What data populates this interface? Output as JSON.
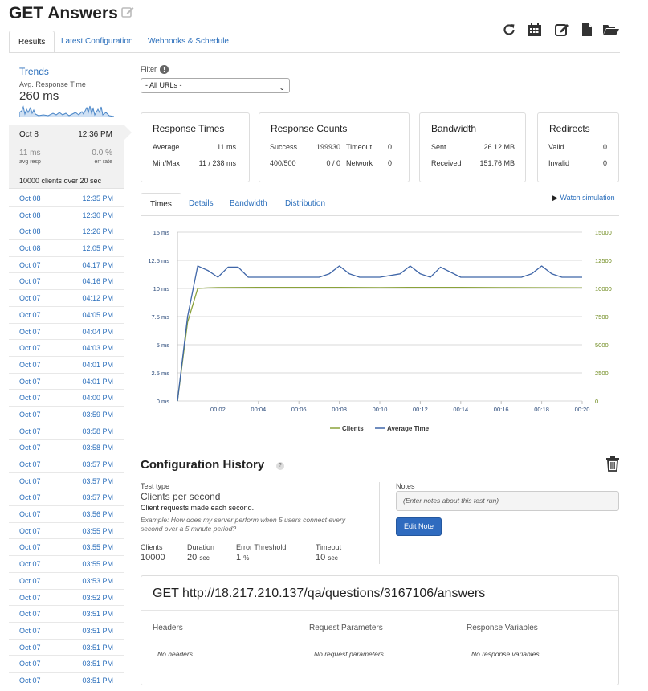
{
  "header": {
    "title": "GET Answers",
    "tabs": [
      {
        "label": "Results",
        "active": true
      },
      {
        "label": "Latest Configuration",
        "active": false
      },
      {
        "label": "Webhooks & Schedule",
        "active": false
      }
    ],
    "toolbar_icons": [
      "refresh-icon",
      "calendar-icon",
      "edit-icon",
      "file-icon",
      "folder-open-icon"
    ]
  },
  "sidebar": {
    "trends_label": "Trends",
    "avg_label": "Avg. Response Time",
    "avg_value": "260 ms",
    "selected": {
      "date": "Oct 8",
      "time": "12:36 PM",
      "resp_value": "11 ms",
      "resp_label": "avg resp",
      "err_value": "0.0 %",
      "err_label": "err rate",
      "summary": "10000 clients over 20 sec"
    },
    "runs": [
      {
        "date": "Oct 08",
        "time": "12:35 PM"
      },
      {
        "date": "Oct 08",
        "time": "12:30 PM"
      },
      {
        "date": "Oct 08",
        "time": "12:26 PM"
      },
      {
        "date": "Oct 08",
        "time": "12:05 PM"
      },
      {
        "date": "Oct 07",
        "time": "04:17 PM"
      },
      {
        "date": "Oct 07",
        "time": "04:16 PM"
      },
      {
        "date": "Oct 07",
        "time": "04:12 PM"
      },
      {
        "date": "Oct 07",
        "time": "04:05 PM"
      },
      {
        "date": "Oct 07",
        "time": "04:04 PM"
      },
      {
        "date": "Oct 07",
        "time": "04:03 PM"
      },
      {
        "date": "Oct 07",
        "time": "04:01 PM"
      },
      {
        "date": "Oct 07",
        "time": "04:01 PM"
      },
      {
        "date": "Oct 07",
        "time": "04:00 PM"
      },
      {
        "date": "Oct 07",
        "time": "03:59 PM"
      },
      {
        "date": "Oct 07",
        "time": "03:58 PM"
      },
      {
        "date": "Oct 07",
        "time": "03:58 PM"
      },
      {
        "date": "Oct 07",
        "time": "03:57 PM"
      },
      {
        "date": "Oct 07",
        "time": "03:57 PM"
      },
      {
        "date": "Oct 07",
        "time": "03:57 PM"
      },
      {
        "date": "Oct 07",
        "time": "03:56 PM"
      },
      {
        "date": "Oct 07",
        "time": "03:55 PM"
      },
      {
        "date": "Oct 07",
        "time": "03:55 PM"
      },
      {
        "date": "Oct 07",
        "time": "03:55 PM"
      },
      {
        "date": "Oct 07",
        "time": "03:53 PM"
      },
      {
        "date": "Oct 07",
        "time": "03:52 PM"
      },
      {
        "date": "Oct 07",
        "time": "03:51 PM"
      },
      {
        "date": "Oct 07",
        "time": "03:51 PM"
      },
      {
        "date": "Oct 07",
        "time": "03:51 PM"
      },
      {
        "date": "Oct 07",
        "time": "03:51 PM"
      },
      {
        "date": "Oct 07",
        "time": "03:51 PM"
      }
    ]
  },
  "filter": {
    "label": "Filter",
    "info_glyph": "!",
    "selected": "- All URLs -"
  },
  "cards": {
    "response_times": {
      "title": "Response Times",
      "average_label": "Average",
      "average_value": "11 ms",
      "minmax_label": "Min/Max",
      "minmax_value": "11 / 238 ms"
    },
    "response_counts": {
      "title": "Response Counts",
      "success_label": "Success",
      "success_value": "199930",
      "timeout_label": "Timeout",
      "timeout_value": "0",
      "r400_label": "400/500",
      "r400_value": "0 / 0",
      "network_label": "Network",
      "network_value": "0"
    },
    "bandwidth": {
      "title": "Bandwidth",
      "sent_label": "Sent",
      "sent_value": "26.12 MB",
      "received_label": "Received",
      "received_value": "151.76 MB"
    },
    "redirects": {
      "title": "Redirects",
      "valid_label": "Valid",
      "valid_value": "0",
      "invalid_label": "Invalid",
      "invalid_value": "0"
    }
  },
  "chart_tabs": [
    {
      "label": "Times",
      "active": true
    },
    {
      "label": "Details",
      "active": false
    },
    {
      "label": "Bandwidth",
      "active": false
    },
    {
      "label": "Distribution",
      "active": false
    }
  ],
  "watch_simulation": "Watch simulation",
  "chart_data": {
    "type": "line",
    "title": "",
    "xlabel": "",
    "ylabel": "",
    "x_ticks": [
      "00:02",
      "00:04",
      "00:06",
      "00:08",
      "00:10",
      "00:12",
      "00:14",
      "00:16",
      "00:18",
      "00:20"
    ],
    "y_left_ticks": [
      "0 ms",
      "2.5 ms",
      "5 ms",
      "7.5 ms",
      "10 ms",
      "12.5 ms",
      "15 ms"
    ],
    "y_right_ticks": [
      "0",
      "2500",
      "5000",
      "7500",
      "10000",
      "12500",
      "15000"
    ],
    "ylim_left": [
      0,
      15
    ],
    "ylim_right": [
      0,
      15000
    ],
    "xlim_seconds": [
      0,
      20
    ],
    "grid": true,
    "legend_position": "bottom",
    "series": [
      {
        "name": "Clients",
        "axis": "right",
        "color": "#8aa23a",
        "x": [
          0,
          0.5,
          1,
          1.5,
          2,
          4,
          6,
          8,
          10,
          12,
          14,
          16,
          18,
          20
        ],
        "values": [
          0,
          7000,
          10000,
          10050,
          10080,
          10100,
          10090,
          10100,
          10080,
          10100,
          10090,
          10080,
          10070,
          10060
        ]
      },
      {
        "name": "Average Time",
        "axis": "left",
        "color": "#3f66a8",
        "x": [
          0,
          0.5,
          1,
          1.5,
          2,
          2.5,
          3,
          3.5,
          4,
          5,
          6,
          7,
          7.5,
          8,
          8.5,
          9,
          10,
          11,
          11.5,
          12,
          12.5,
          13,
          14,
          15,
          16,
          17,
          17.5,
          18,
          18.5,
          19,
          20
        ],
        "values": [
          0,
          7.5,
          12,
          11.6,
          11,
          11.9,
          11.9,
          11,
          11,
          11,
          11,
          11,
          11.3,
          12,
          11.3,
          11,
          11,
          11.3,
          12,
          11.3,
          11,
          11.9,
          11,
          11,
          11,
          11,
          11.3,
          12,
          11.3,
          11,
          11
        ]
      }
    ]
  },
  "config": {
    "title": "Configuration History",
    "help_glyph": "?",
    "test_type_label": "Test type",
    "test_type_value": "Clients per second",
    "test_type_desc": "Client requests made each second.",
    "test_type_example": "Example: How does my server perform when 5 users connect every second over a 5 minute period?",
    "params": [
      {
        "label": "Clients",
        "value": "10000",
        "unit": ""
      },
      {
        "label": "Duration",
        "value": "20",
        "unit": "sec"
      },
      {
        "label": "Error Threshold",
        "value": "1",
        "unit": "%"
      },
      {
        "label": "Timeout",
        "value": "10",
        "unit": "sec"
      }
    ],
    "notes_label": "Notes",
    "notes_placeholder": "(Enter notes about this test run)",
    "edit_note_label": "Edit Note"
  },
  "request": {
    "url": "GET http://18.217.210.137/qa/questions/3167106/answers",
    "headers_title": "Headers",
    "headers_empty": "No headers",
    "params_title": "Request Parameters",
    "params_empty": "No request parameters",
    "vars_title": "Response Variables",
    "vars_empty": "No response variables"
  },
  "colors": {
    "link": "#2a6ebb",
    "clients_line": "#8aa23a",
    "avg_time_line": "#3f66a8",
    "button": "#2f6bbf"
  }
}
